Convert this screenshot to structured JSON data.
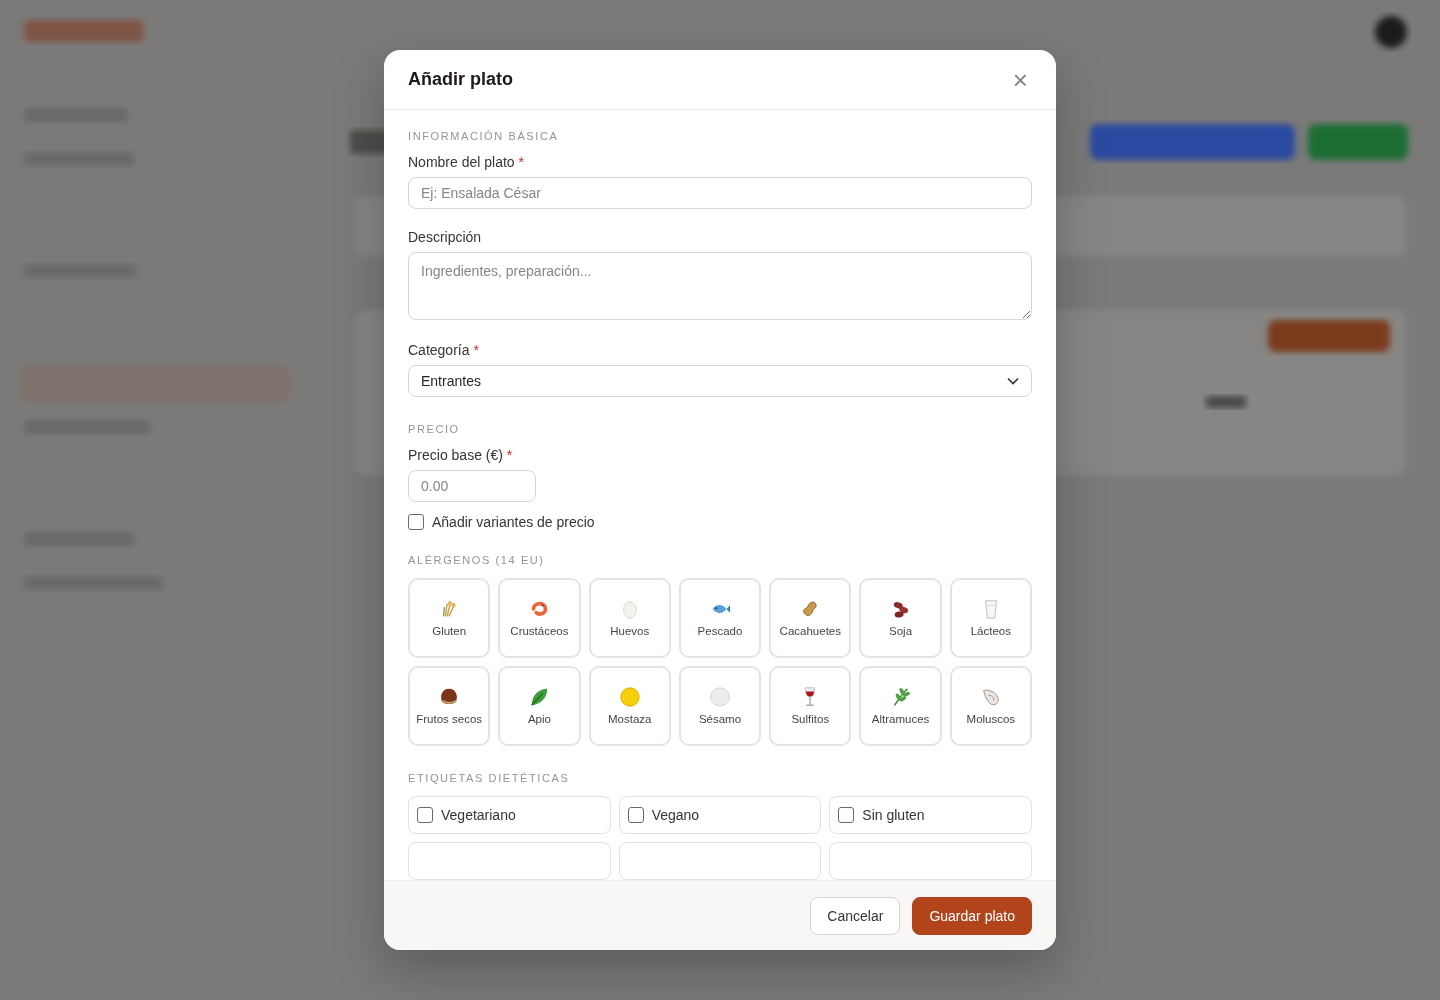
{
  "dialog": {
    "title": "Añadir plato",
    "close": "×"
  },
  "sections": [
    {
      "title": "INFORMACIÓN BÁSICA"
    },
    {
      "title": "PRECIO"
    },
    {
      "title": "ALÉRGENOS (14 EU)"
    },
    {
      "title": "ETIQUETAS DIETÉTICAS"
    }
  ],
  "name_field": {
    "label": "Nombre del plato",
    "required_mark": "*",
    "placeholder": "Ej: Ensalada César"
  },
  "description_field": {
    "label": "Descripción",
    "placeholder": "Ingredientes, preparación..."
  },
  "category_field": {
    "label": "Categoría",
    "required_mark": "*",
    "value": "Entrantes"
  },
  "price_field": {
    "label": "Precio base (€)",
    "required_mark": "*",
    "placeholder": "0.00"
  },
  "variants": {
    "label": "Añadir variantes de precio",
    "checked": false
  },
  "allergens": [
    {
      "label": "Gluten",
      "selected": false
    },
    {
      "label": "Crustáceos",
      "selected": false
    },
    {
      "label": "Huevos",
      "selected": false
    },
    {
      "label": "Pescado",
      "selected": false
    },
    {
      "label": "Cacahuetes",
      "selected": false
    },
    {
      "label": "Soja",
      "selected": false
    },
    {
      "label": "Lácteos",
      "selected": false
    },
    {
      "label": "Frutos secos",
      "selected": false
    },
    {
      "label": "Apio",
      "selected": false
    },
    {
      "label": "Mostaza",
      "selected": false
    },
    {
      "label": "Sésamo",
      "selected": false
    },
    {
      "label": "Sulfitos",
      "selected": false
    },
    {
      "label": "Altramuces",
      "selected": false
    },
    {
      "label": "Moluscos",
      "selected": false
    }
  ],
  "diet_tags": [
    {
      "label": "Vegetariano",
      "checked": false
    },
    {
      "label": "Vegano",
      "checked": false
    },
    {
      "label": "Sin gluten",
      "checked": false
    }
  ],
  "buttons": [
    {
      "label": "Cancelar",
      "kind": "secondary"
    },
    {
      "label": "Guardar plato",
      "kind": "primary"
    }
  ]
}
